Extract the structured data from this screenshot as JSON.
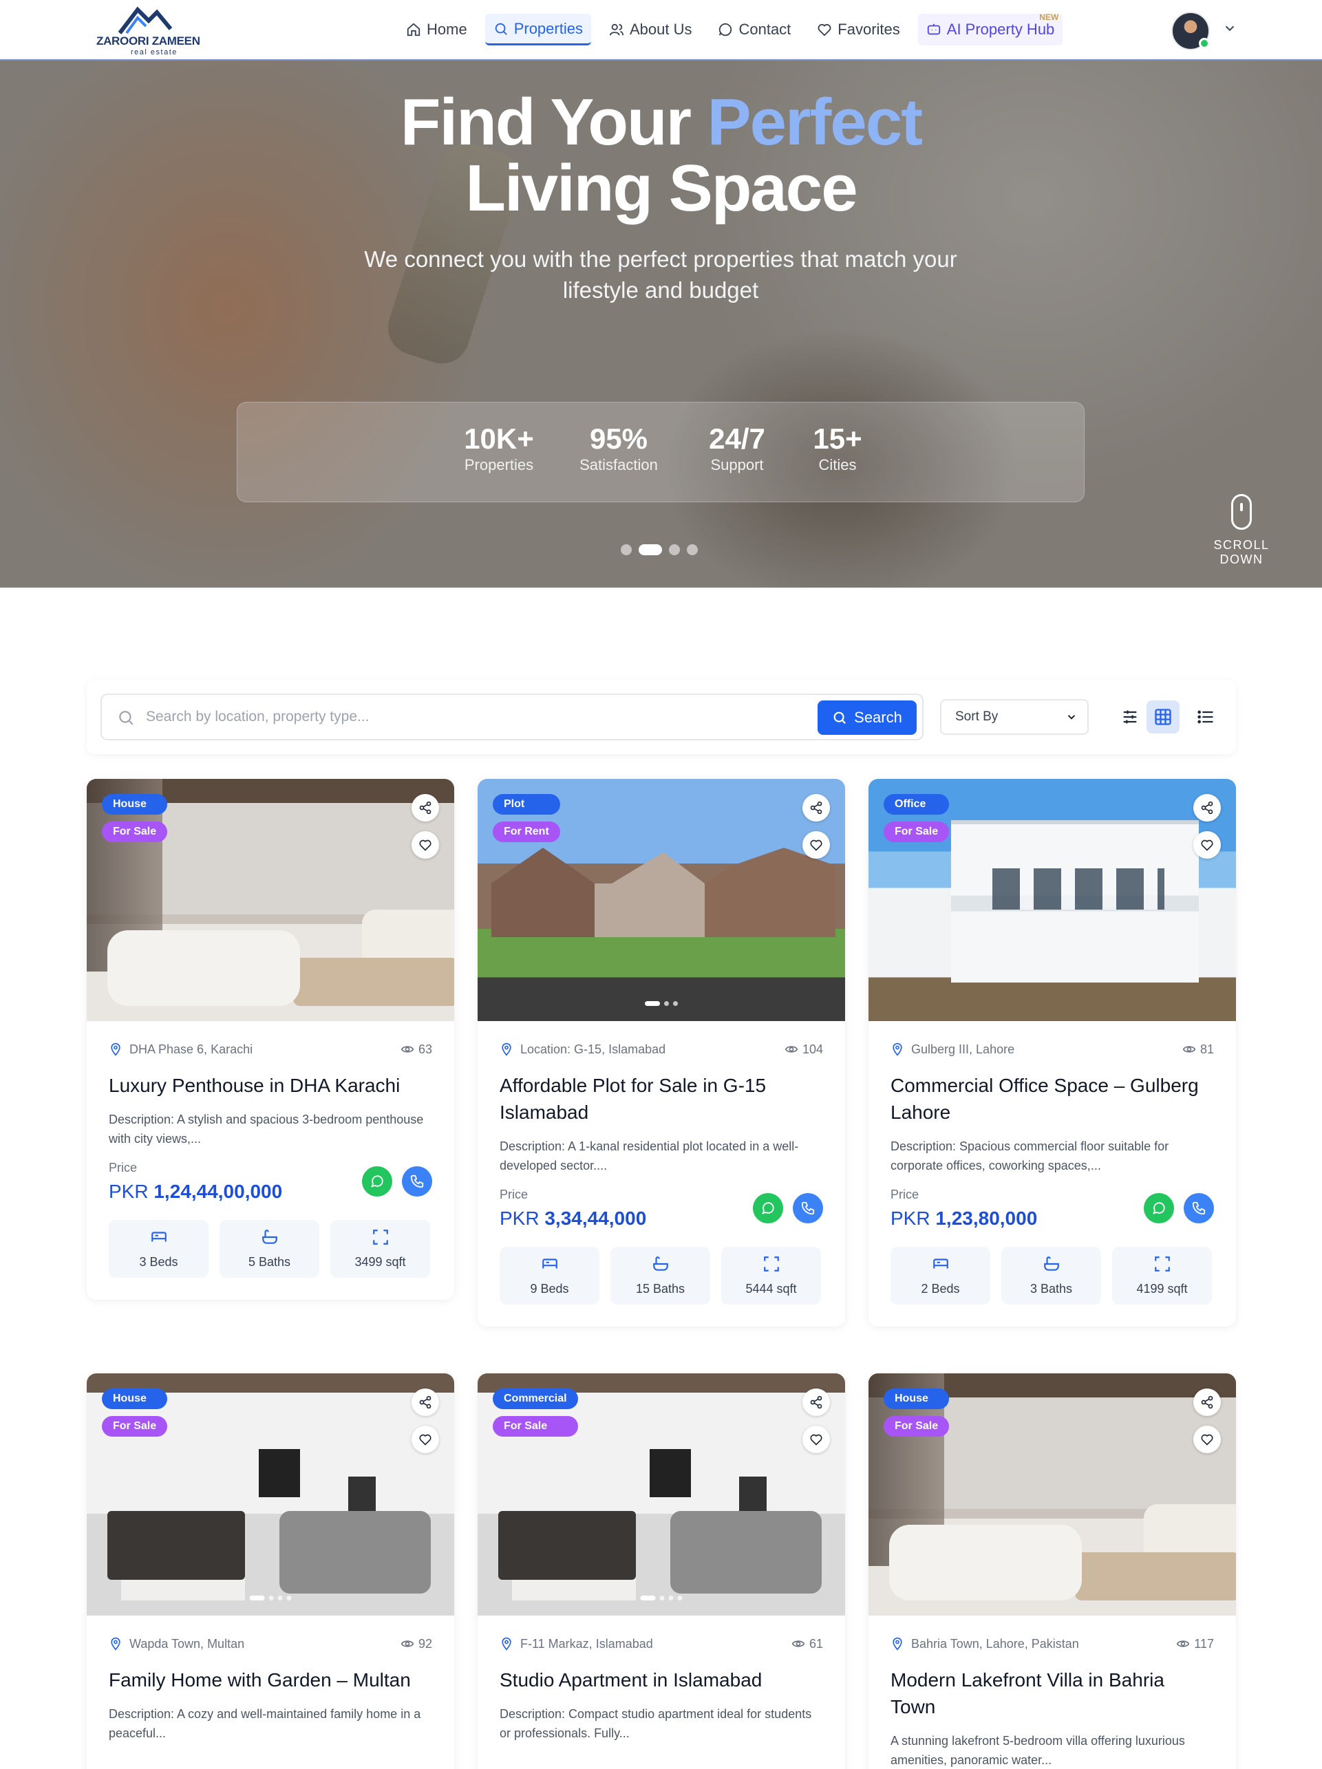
{
  "nav": {
    "brand": "ZAROORI ZAMEEN",
    "brand_sub": "real estate",
    "items": [
      {
        "label": "Home",
        "icon": "home-icon"
      },
      {
        "label": "Properties",
        "icon": "search-icon"
      },
      {
        "label": "About Us",
        "icon": "users-icon"
      },
      {
        "label": "Contact",
        "icon": "chat-icon"
      },
      {
        "label": "Favorites",
        "icon": "heart-icon"
      },
      {
        "label": "AI Property Hub",
        "icon": "bot-icon"
      }
    ],
    "new_badge": "NEW"
  },
  "hero": {
    "title_part1": "Find Your ",
    "title_accent": "Perfect",
    "title_line2": "Living Space",
    "subtitle": "We connect you with the perfect properties that match your lifestyle and budget",
    "stats": [
      {
        "value": "10K+",
        "label": "Properties"
      },
      {
        "value": "95%",
        "label": "Satisfaction"
      },
      {
        "value": "24/7",
        "label": "Support"
      },
      {
        "value": "15+",
        "label": "Cities"
      }
    ],
    "scroll_label": "SCROLL DOWN"
  },
  "search": {
    "placeholder": "Search by location, property type...",
    "button": "Search",
    "sort_label": "Sort By"
  },
  "currency": "PKR",
  "price_label": "Price",
  "properties": [
    {
      "type": "House",
      "status": "For Sale",
      "location": "DHA Phase 6, Karachi",
      "views": "63",
      "title": "Luxury Penthouse in DHA Karachi",
      "description": "Description: A stylish and spacious 3-bedroom penthouse with city views,...",
      "price": "1,24,44,00,000",
      "beds": "3 Beds",
      "baths": "5 Baths",
      "area": "3499 sqft"
    },
    {
      "type": "Plot",
      "status": "For Rent",
      "location": "Location: G-15, Islamabad",
      "views": "104",
      "title": "Affordable Plot for Sale in G-15 Islamabad",
      "description": "Description: A 1-kanal residential plot located in a well-developed sector....",
      "price": "3,34,44,000",
      "beds": "9 Beds",
      "baths": "15 Baths",
      "area": "5444 sqft"
    },
    {
      "type": "Office",
      "status": "For Sale",
      "location": "Gulberg III, Lahore",
      "views": "81",
      "title": "Commercial Office Space – Gulberg Lahore",
      "description": "Description: Spacious commercial floor suitable for corporate offices, coworking spaces,...",
      "price": "1,23,80,000",
      "beds": "2 Beds",
      "baths": "3 Baths",
      "area": "4199 sqft"
    },
    {
      "type": "House",
      "status": "For Sale",
      "location": "Wapda Town, Multan",
      "views": "92",
      "title": "Family Home with Garden – Multan",
      "description": "Description: A cozy and well-maintained family home in a peaceful..."
    },
    {
      "type": "Commercial",
      "status": "For Sale",
      "location": "F-11 Markaz, Islamabad",
      "views": "61",
      "title": "Studio Apartment in Islamabad",
      "description": "Description: Compact studio apartment ideal for students or professionals. Fully..."
    },
    {
      "type": "House",
      "status": "For Sale",
      "location": "Bahria Town, Lahore, Pakistan",
      "views": "117",
      "title": "Modern Lakefront Villa in Bahria Town",
      "description": "A stunning lakefront 5-bedroom villa offering luxurious amenities, panoramic water..."
    }
  ]
}
